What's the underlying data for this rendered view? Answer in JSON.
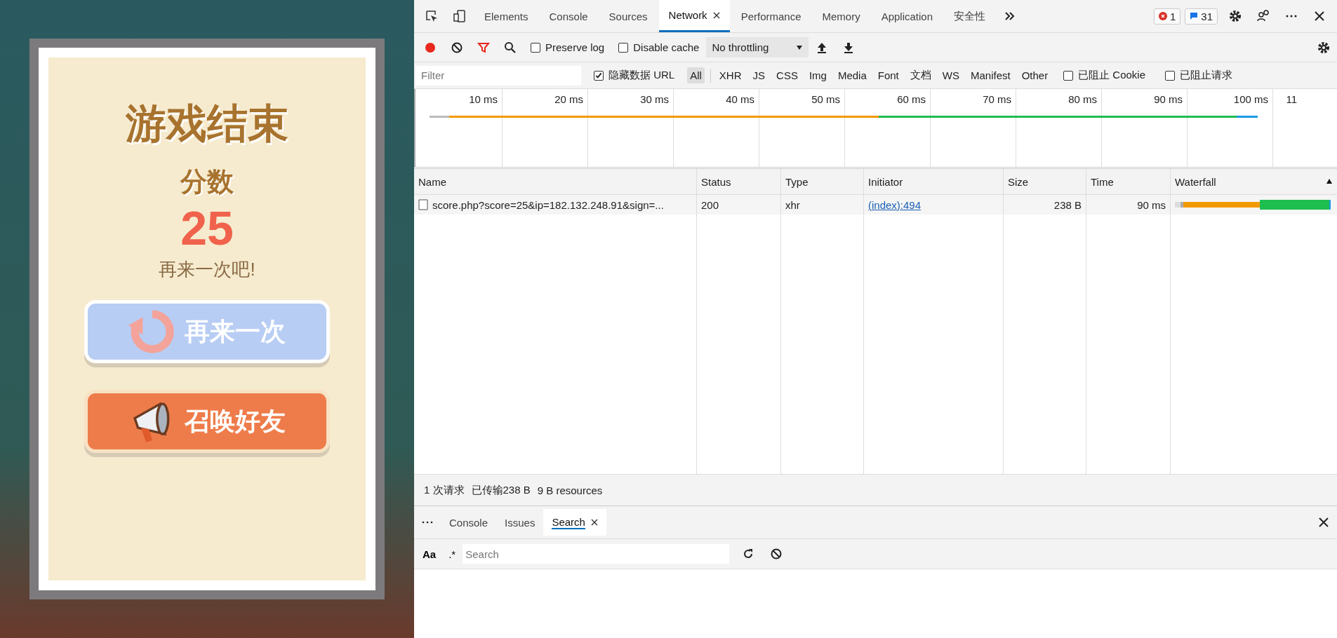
{
  "game": {
    "title": "游戏结束",
    "score_label": "分数",
    "score": "25",
    "message": "再来一次吧!",
    "buttons": [
      {
        "label": "再来一次",
        "kind": "retry"
      },
      {
        "label": "召唤好友",
        "kind": "invite"
      }
    ]
  },
  "devtools": {
    "tabs": [
      {
        "label": "Elements",
        "selected": false
      },
      {
        "label": "Console",
        "selected": false
      },
      {
        "label": "Sources",
        "selected": false
      },
      {
        "label": "Network",
        "selected": true
      },
      {
        "label": "Performance",
        "selected": false
      },
      {
        "label": "Memory",
        "selected": false
      },
      {
        "label": "Application",
        "selected": false
      },
      {
        "label": "安全性",
        "selected": false
      }
    ],
    "error_count": "1",
    "message_count": "31",
    "toolbar": {
      "recording": true,
      "preserve_log": {
        "label": "Preserve log",
        "checked": false
      },
      "disable_cache": {
        "label": "Disable cache",
        "checked": false
      },
      "throttling": "No throttling"
    },
    "filter": {
      "placeholder": "Filter",
      "hide_data_urls": {
        "label": "隐藏数据 URL",
        "checked": true
      },
      "types": [
        {
          "label": "All",
          "selected": true
        },
        {
          "label": "XHR",
          "selected": false
        },
        {
          "label": "JS",
          "selected": false
        },
        {
          "label": "CSS",
          "selected": false
        },
        {
          "label": "Img",
          "selected": false
        },
        {
          "label": "Media",
          "selected": false
        },
        {
          "label": "Font",
          "selected": false
        },
        {
          "label": "文档",
          "selected": false
        },
        {
          "label": "WS",
          "selected": false
        },
        {
          "label": "Manifest",
          "selected": false
        },
        {
          "label": "Other",
          "selected": false
        }
      ],
      "blocked_cookies": {
        "label": "已阻止 Cookie",
        "checked": false
      },
      "blocked_requests": {
        "label": "已阻止请求",
        "checked": false
      }
    },
    "timeline_ticks": [
      "10 ms",
      "20 ms",
      "30 ms",
      "40 ms",
      "50 ms",
      "60 ms",
      "70 ms",
      "80 ms",
      "90 ms",
      "100 ms",
      "11"
    ],
    "table": {
      "columns": [
        "Name",
        "Status",
        "Type",
        "Initiator",
        "Size",
        "Time",
        "Waterfall"
      ],
      "rows": [
        {
          "name": "score.php?score=25&ip=182.132.248.91&sign=...",
          "status": "200",
          "type": "xhr",
          "initiator": "(index):494",
          "size": "238 B",
          "time": "90 ms"
        }
      ]
    },
    "status_bar": [
      "1 次请求",
      "已传输238 B",
      "9 B resources"
    ],
    "drawer": {
      "tabs": [
        {
          "label": "Console",
          "selected": false,
          "closable": false
        },
        {
          "label": "Issues",
          "selected": false,
          "closable": false
        },
        {
          "label": "Search",
          "selected": true,
          "closable": true
        }
      ],
      "case_toggle": "Aa",
      "regex_toggle": ".*",
      "search_placeholder": "Search"
    }
  }
}
